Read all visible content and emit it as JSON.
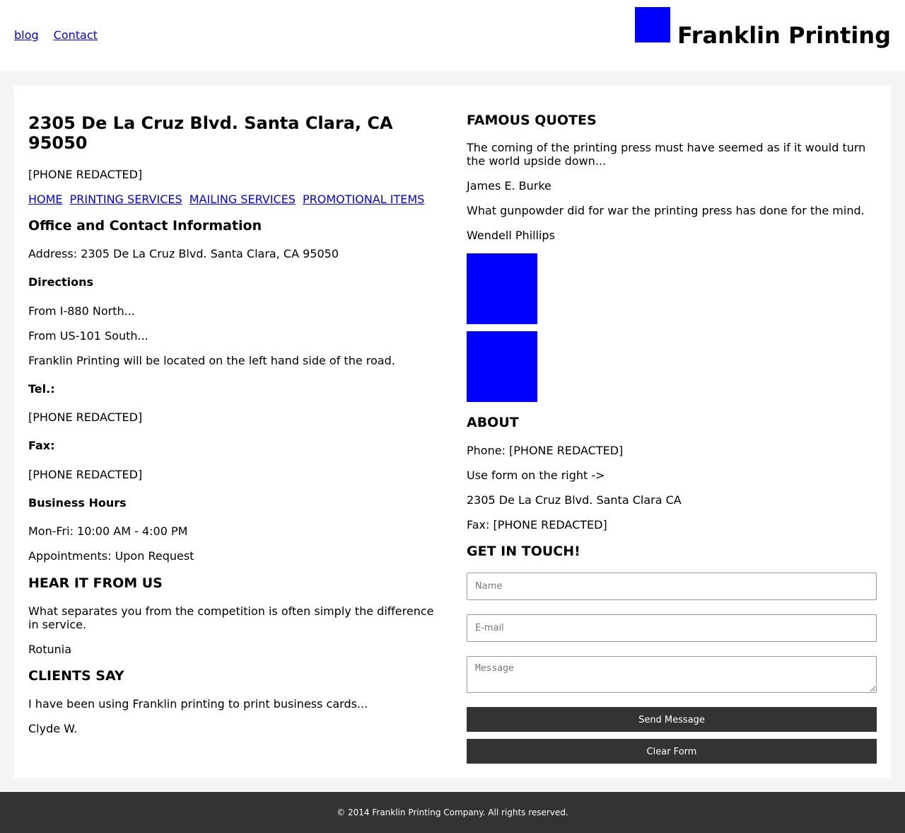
{
  "header": {
    "nav": [
      {
        "label": "blog"
      },
      {
        "label": "Contact"
      }
    ],
    "title": "Franklin Printing"
  },
  "left": {
    "address_heading": "2305 De La Cruz Blvd. Santa Clara, CA 95050",
    "phone": "[PHONE REDACTED]",
    "nav": [
      {
        "label": "HOME"
      },
      {
        "label": "PRINTING SERVICES"
      },
      {
        "label": "MAILING SERVICES"
      },
      {
        "label": "PROMOTIONAL ITEMS"
      }
    ],
    "office_heading": "Office and Contact Information",
    "address_line": "Address: 2305 De La Cruz Blvd. Santa Clara, CA 95050",
    "directions_heading": "Directions",
    "directions": [
      "From I-880 North...",
      "From US-101 South...",
      "Franklin Printing will be located on the left hand side of the road."
    ],
    "tel_heading": "Tel.:",
    "tel_value": "[PHONE REDACTED]",
    "fax_heading": "Fax:",
    "fax_value": "[PHONE REDACTED]",
    "hours_heading": "Business Hours",
    "hours": [
      "Mon-Fri: 10:00 AM - 4:00 PM",
      "Appointments: Upon Request"
    ],
    "hear_heading": "HEAR IT FROM US",
    "hear_quote": "What separates you from the competition is often simply the difference in service.",
    "hear_author": "Rotunia",
    "clients_heading": "CLIENTS SAY",
    "clients_quote": "I have been using Franklin printing to print business cards...",
    "clients_author": "Clyde W."
  },
  "right": {
    "quotes_heading": "FAMOUS QUOTES",
    "quote1": "The coming of the printing press must have seemed as if it would turn the world upside down...",
    "quote1_author": "James E. Burke",
    "quote2": "What gunpowder did for war the printing press has done for the mind.",
    "quote2_author": "Wendell Phillips",
    "about_heading": "ABOUT",
    "about_phone": "Phone: [PHONE REDACTED]",
    "about_form_hint": "Use form on the right ->",
    "about_address": "2305 De La Cruz Blvd. Santa Clara CA",
    "about_fax": "Fax: [PHONE REDACTED]",
    "contact_heading": "GET IN TOUCH!",
    "form": {
      "name_placeholder": "Name",
      "email_placeholder": "E-mail",
      "message_placeholder": "Message",
      "send_label": "Send Message",
      "clear_label": "Clear Form"
    }
  },
  "footer": {
    "copyright": "© 2014 Franklin Printing Company. All rights reserved."
  }
}
